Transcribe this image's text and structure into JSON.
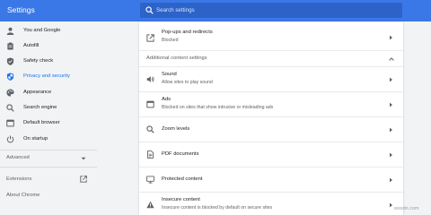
{
  "header": {
    "title": "Settings",
    "search_placeholder": "Search settings"
  },
  "sidebar": {
    "items": [
      {
        "label": "You and Google",
        "icon": "person-icon"
      },
      {
        "label": "Autofill",
        "icon": "clipboard-icon"
      },
      {
        "label": "Safety check",
        "icon": "shield-check-icon"
      },
      {
        "label": "Privacy and security",
        "icon": "shield-icon",
        "active": true
      },
      {
        "label": "Appearance",
        "icon": "palette-icon"
      },
      {
        "label": "Search engine",
        "icon": "search-icon"
      },
      {
        "label": "Default browser",
        "icon": "browser-icon"
      },
      {
        "label": "On startup",
        "icon": "power-icon"
      }
    ],
    "advanced_label": "Advanced",
    "extensions_label": "Extensions",
    "about_label": "About Chrome"
  },
  "content": {
    "popups": {
      "title": "Pop-ups and redirects",
      "subtitle": "Blocked"
    },
    "section_title": "Additional content settings",
    "rows": [
      {
        "title": "Sound",
        "subtitle": "Allow sites to play sound",
        "icon": "speaker-icon"
      },
      {
        "title": "Ads",
        "subtitle": "Blocked on sites that show intrusive or misleading ads",
        "icon": "ads-icon"
      },
      {
        "title": "Zoom levels",
        "subtitle": "",
        "icon": "zoom-icon"
      },
      {
        "title": "PDF documents",
        "subtitle": "",
        "icon": "document-icon"
      },
      {
        "title": "Protected content",
        "subtitle": "",
        "icon": "monitor-icon"
      },
      {
        "title": "Insecure content",
        "subtitle": "Insecure content is blocked by default on secure sites",
        "icon": "warning-icon"
      }
    ]
  },
  "colors": {
    "accent": "#1a73e8",
    "header": "#3b78e7"
  },
  "watermark": "wsxdn.com"
}
